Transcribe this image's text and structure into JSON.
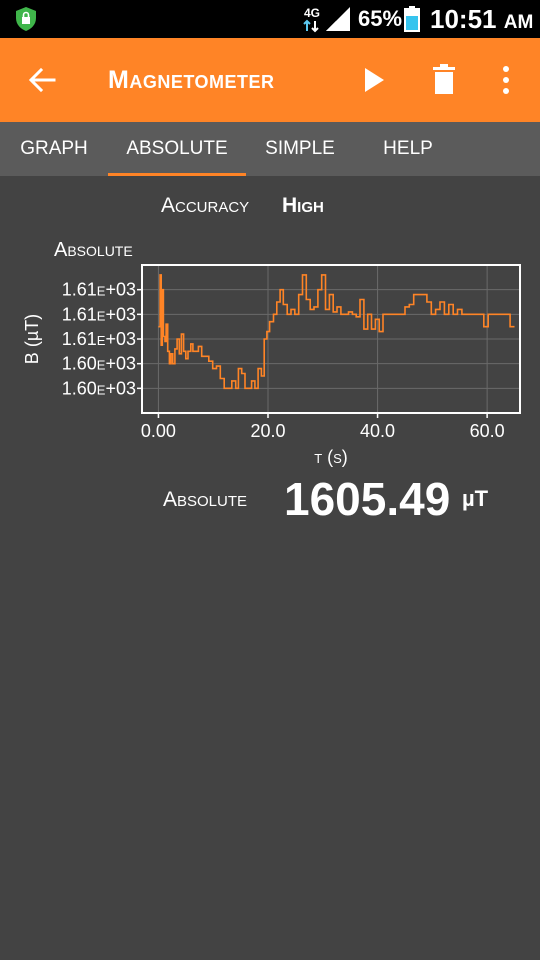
{
  "status_bar": {
    "network": "4G",
    "battery_percent": "65%",
    "time": "10:51",
    "ampm": "AM",
    "icons": [
      "shield-lock-icon",
      "network-arrows-icon",
      "signal-icon",
      "battery-icon"
    ]
  },
  "app_bar": {
    "title": "Magnetometer",
    "color": "#ff8426",
    "icons": [
      "back-arrow-icon",
      "play-icon",
      "trash-icon",
      "more-vert-icon"
    ]
  },
  "tabs": [
    {
      "label": "GRAPH",
      "active": false
    },
    {
      "label": "ABSOLUTE",
      "active": true
    },
    {
      "label": "SIMPLE",
      "active": false
    },
    {
      "label": "HELP",
      "active": false
    }
  ],
  "accuracy": {
    "label": "Accuracy",
    "value": "High"
  },
  "chart_data": {
    "type": "line",
    "title": "Absolute",
    "xlabel": "t (s)",
    "ylabel": "B (µT)",
    "xlim": [
      -3,
      66
    ],
    "ylim": [
      1605.2,
      1606.4
    ],
    "xticks": [
      0,
      20,
      40,
      60
    ],
    "xtick_labels": [
      "0.00",
      "20.0",
      "40.0",
      "60.0"
    ],
    "yticks": [
      1605.4,
      1605.6,
      1605.8,
      1606.0,
      1606.2
    ],
    "ytick_labels": [
      "1.60e+03",
      "1.60e+03",
      "1.61e+03",
      "1.61e+03",
      "1.61e+03"
    ],
    "grid": true,
    "line_color": "#ff8426",
    "series": [
      {
        "x": [
          0,
          0.3,
          0.5,
          0.7,
          0.9,
          1.2,
          1.4,
          1.7,
          2.0,
          2.3,
          2.6,
          3.0,
          3.4,
          3.8,
          4.2,
          4.6,
          5.0,
          5.4,
          5.9,
          6.3,
          6.8,
          7.3,
          7.9,
          8.5,
          9.2,
          9.9,
          10.6,
          11.3,
          12.0,
          12.7,
          13.4,
          14.1,
          14.6,
          15.2,
          15.8,
          16.4,
          17.0,
          17.6,
          18.2,
          18.8,
          19.3,
          19.8,
          20.3,
          21.0,
          21.6,
          22.2,
          22.8,
          23.5,
          24.2,
          24.9,
          25.6,
          26.3,
          27.0,
          27.7,
          28.4,
          29.1,
          29.8,
          30.5,
          31.2,
          31.9,
          32.6,
          33.3,
          34.0,
          34.7,
          35.4,
          36.1,
          36.8,
          37.5,
          38.2,
          38.9,
          39.6,
          40.3,
          41.0,
          41.8,
          42.6,
          43.4,
          44.2,
          45.0,
          45.8,
          46.6,
          47.4,
          48.2,
          49.0,
          49.8,
          50.6,
          51.4,
          52.2,
          53.0,
          53.8,
          54.6,
          55.4,
          56.2,
          57.0,
          57.8,
          58.6,
          59.4,
          60.2,
          61.0,
          61.8,
          62.6,
          63.4,
          64.2,
          65.0
        ],
        "y": [
          1605.9,
          1606.32,
          1605.75,
          1606.2,
          1605.82,
          1605.78,
          1605.92,
          1605.7,
          1605.6,
          1605.68,
          1605.6,
          1605.72,
          1605.8,
          1605.68,
          1605.84,
          1605.7,
          1605.64,
          1605.7,
          1605.76,
          1605.7,
          1605.7,
          1605.74,
          1605.66,
          1605.66,
          1605.62,
          1605.56,
          1605.58,
          1605.48,
          1605.4,
          1605.4,
          1605.46,
          1605.4,
          1605.56,
          1605.52,
          1605.4,
          1605.4,
          1605.46,
          1605.4,
          1605.56,
          1605.5,
          1605.8,
          1605.86,
          1605.94,
          1606.0,
          1606.1,
          1606.2,
          1606.08,
          1606.0,
          1606.04,
          1606.0,
          1606.16,
          1606.32,
          1606.12,
          1606.04,
          1606.06,
          1606.2,
          1606.32,
          1606.04,
          1606.16,
          1606.02,
          1606.06,
          1606.0,
          1606.0,
          1606.02,
          1606.0,
          1605.98,
          1606.12,
          1605.88,
          1606.0,
          1605.88,
          1605.96,
          1605.86,
          1606.0,
          1606.0,
          1606.0,
          1606.0,
          1606.0,
          1606.06,
          1606.08,
          1606.16,
          1606.16,
          1606.16,
          1606.1,
          1606.0,
          1606.04,
          1606.1,
          1606.0,
          1606.08,
          1606.0,
          1606.04,
          1606.0,
          1606.0,
          1606.0,
          1606.0,
          1606.0,
          1605.9,
          1606.0,
          1606.0,
          1606.0,
          1606.0,
          1606.0,
          1605.9,
          1605.9
        ]
      }
    ]
  },
  "absolute": {
    "label": "Absolute",
    "value": "1605.49",
    "unit": "µT"
  }
}
